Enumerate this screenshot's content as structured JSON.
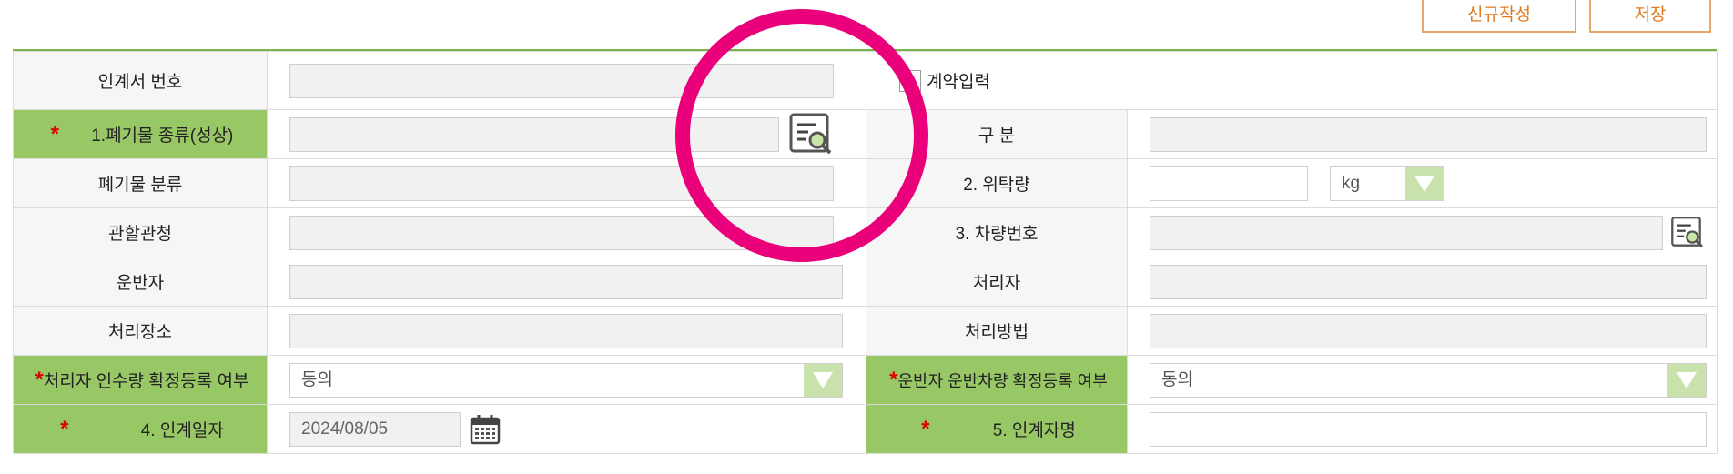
{
  "toolbar": {
    "new_label": "신규작성",
    "save_label": "저장"
  },
  "form": {
    "handover_no_label": "인계서 번호",
    "contract_input_label": "계약입력",
    "waste_type_label": "1.폐기물 종류(성상)",
    "category_label": "구 분",
    "waste_class_label": "폐기물 분류",
    "consign_qty_label": "2. 위탁량",
    "unit_value": "kg",
    "authority_label": "관할관청",
    "vehicle_no_label": "3. 차량번호",
    "transporter_label": "운반자",
    "processor_label": "처리자",
    "place_label": "처리장소",
    "method_label": "처리방법",
    "proc_confirm_label": "처리자 인수량 확정등록 여부",
    "proc_confirm_value": "동의",
    "trans_confirm_label": "운반자 운반차량 확정등록 여부",
    "trans_confirm_value": "동의",
    "handover_date_label": "4. 인계일자",
    "handover_date_value": "2024/08/05",
    "handover_name_label": "5. 인계자명",
    "required_mark": "*"
  },
  "colors": {
    "accent_green": "#98c766",
    "line_green": "#7bb34a",
    "button_orange": "#e07b1f",
    "ring_pink": "#ea007a"
  },
  "icons": {
    "search": "search-list-icon",
    "calendar": "calendar-icon",
    "dropdown": "dropdown-arrow-icon"
  }
}
